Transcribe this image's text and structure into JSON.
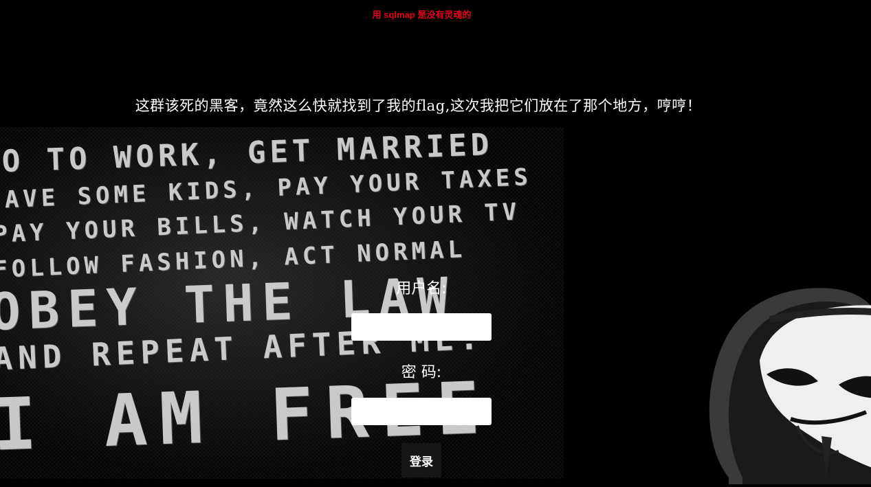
{
  "top_hint": "用 sqlmap 是没有灵魂的",
  "headline": "这群该死的黑客，竟然这么快就找到了我的flag,这次我把它们放在了那个地方，哼哼！",
  "background_poster": {
    "lines": [
      "GO TO WORK, GET MARRIED",
      "HAVE SOME KIDS, PAY YOUR TAXES",
      "PAY YOUR BILLS, WATCH YOUR TV",
      "FOLLOW FASHION, ACT NORMAL",
      "OBEY THE LAW",
      "AND REPEAT AFTER ME:",
      "I AM FREE"
    ]
  },
  "form": {
    "username_label": "用户名:",
    "password_label": "密 码:",
    "username_value": "",
    "password_value": "",
    "submit_label": "登录"
  },
  "colors": {
    "background": "#000000",
    "hint": "#e3001b",
    "text": "#ffffff",
    "button_bg": "#161616"
  }
}
